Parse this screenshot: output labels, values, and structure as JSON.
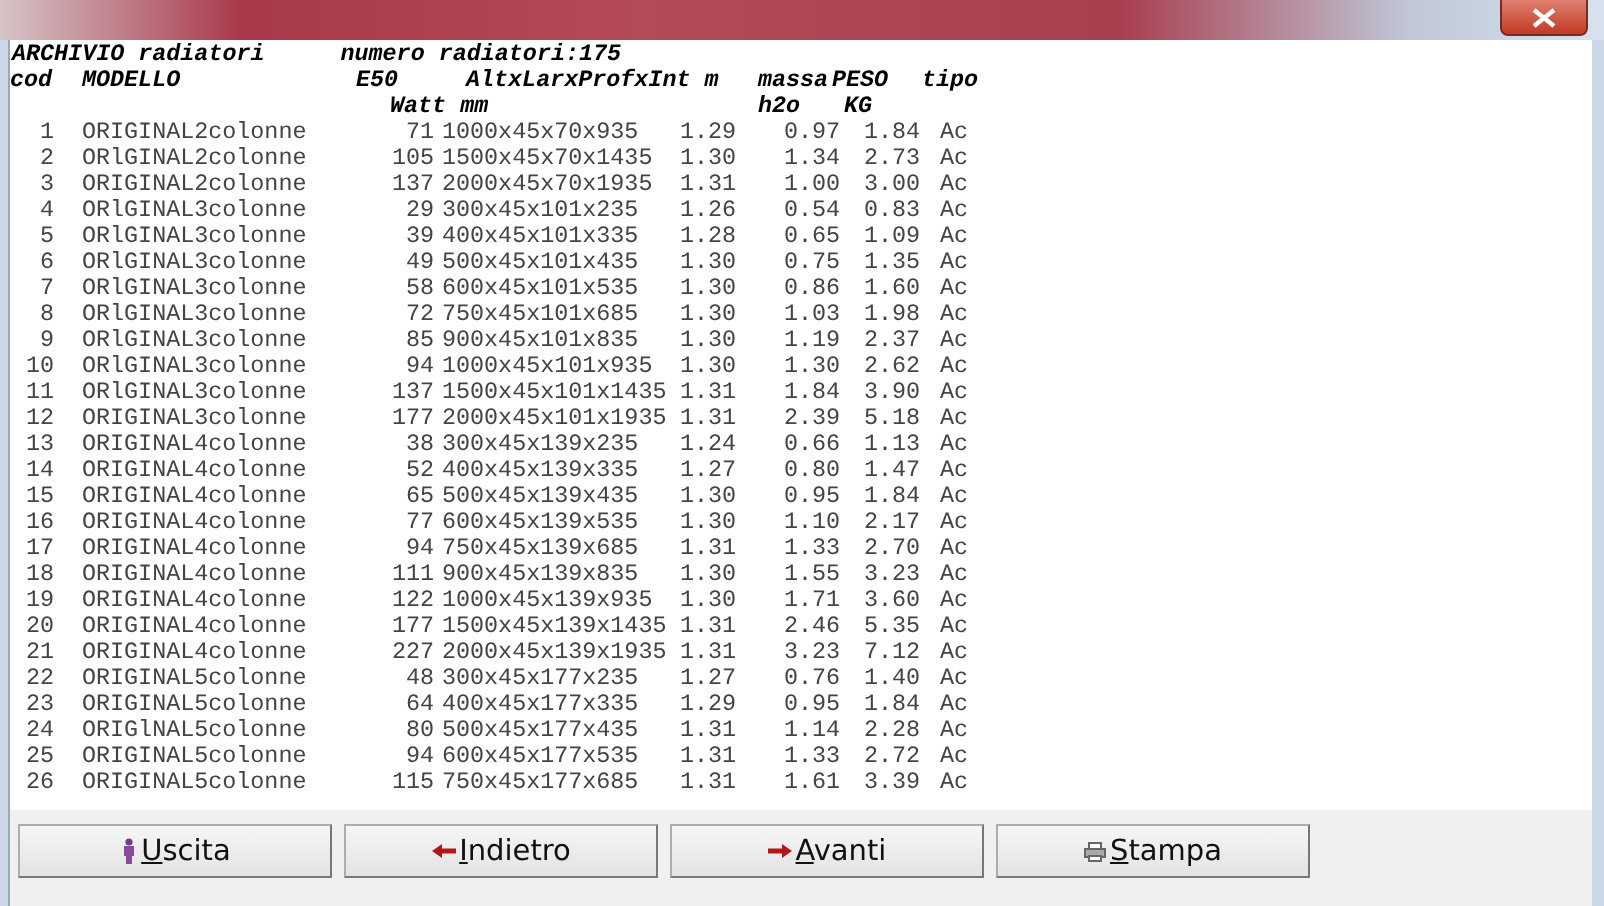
{
  "header": {
    "title": "ARCHIVIO radiatori",
    "count": "numero radiatori:175"
  },
  "columns": {
    "cod": "cod",
    "model": "MODELLO",
    "e50": "E50",
    "dims": "AltxLarxProfxInt m",
    "massa": "massa",
    "peso": "PESO",
    "tipo": "tipo"
  },
  "units": {
    "e50": "Watt mm",
    "massa": "h2o",
    "peso": "KG"
  },
  "rows": [
    {
      "cod": "1",
      "model": "ORIGINAL2colonne",
      "e50": "71",
      "dims": "1000x45x70x935",
      "m": "1.29",
      "massa": "0.97",
      "peso": "1.84",
      "tipo": "Ac"
    },
    {
      "cod": "2",
      "model": "ORlGINAL2colonne",
      "e50": "105",
      "dims": "1500x45x70x1435",
      "m": "1.30",
      "massa": "1.34",
      "peso": "2.73",
      "tipo": "Ac"
    },
    {
      "cod": "3",
      "model": "ORIGINAL2colonne",
      "e50": "137",
      "dims": "2000x45x70x1935",
      "m": "1.31",
      "massa": "1.00",
      "peso": "3.00",
      "tipo": "Ac"
    },
    {
      "cod": "4",
      "model": "ORlGINAL3colonne",
      "e50": "29",
      "dims": "300x45x101x235",
      "m": "1.26",
      "massa": "0.54",
      "peso": "0.83",
      "tipo": "Ac"
    },
    {
      "cod": "5",
      "model": "ORlGINAL3colonne",
      "e50": "39",
      "dims": "400x45x101x335",
      "m": "1.28",
      "massa": "0.65",
      "peso": "1.09",
      "tipo": "Ac"
    },
    {
      "cod": "6",
      "model": "ORlGINAL3colonne",
      "e50": "49",
      "dims": "500x45x101x435",
      "m": "1.30",
      "massa": "0.75",
      "peso": "1.35",
      "tipo": "Ac"
    },
    {
      "cod": "7",
      "model": "ORlGINAL3colonne",
      "e50": "58",
      "dims": "600x45x101x535",
      "m": "1.30",
      "massa": "0.86",
      "peso": "1.60",
      "tipo": "Ac"
    },
    {
      "cod": "8",
      "model": "ORlGINAL3colonne",
      "e50": "72",
      "dims": "750x45x101x685",
      "m": "1.30",
      "massa": "1.03",
      "peso": "1.98",
      "tipo": "Ac"
    },
    {
      "cod": "9",
      "model": "ORlGINAL3colonne",
      "e50": "85",
      "dims": "900x45x101x835",
      "m": "1.30",
      "massa": "1.19",
      "peso": "2.37",
      "tipo": "Ac"
    },
    {
      "cod": "10",
      "model": "ORlGINAL3colonne",
      "e50": "94",
      "dims": "1000x45x101x935",
      "m": "1.30",
      "massa": "1.30",
      "peso": "2.62",
      "tipo": "Ac"
    },
    {
      "cod": "11",
      "model": "ORlGINAL3colonne",
      "e50": "137",
      "dims": "1500x45x101x1435",
      "m": "1.31",
      "massa": "1.84",
      "peso": "3.90",
      "tipo": "Ac"
    },
    {
      "cod": "12",
      "model": "ORIGINAL3colonne",
      "e50": "177",
      "dims": "2000x45x101x1935",
      "m": "1.31",
      "massa": "2.39",
      "peso": "5.18",
      "tipo": "Ac"
    },
    {
      "cod": "13",
      "model": "ORIGINAL4colonne",
      "e50": "38",
      "dims": "300x45x139x235",
      "m": "1.24",
      "massa": "0.66",
      "peso": "1.13",
      "tipo": "Ac"
    },
    {
      "cod": "14",
      "model": "ORIGINAL4colonne",
      "e50": "52",
      "dims": "400x45x139x335",
      "m": "1.27",
      "massa": "0.80",
      "peso": "1.47",
      "tipo": "Ac"
    },
    {
      "cod": "15",
      "model": "ORIGINAL4colonne",
      "e50": "65",
      "dims": "500x45x139x435",
      "m": "1.30",
      "massa": "0.95",
      "peso": "1.84",
      "tipo": "Ac"
    },
    {
      "cod": "16",
      "model": "ORIGINAL4colonne",
      "e50": "77",
      "dims": "600x45x139x535",
      "m": "1.30",
      "massa": "1.10",
      "peso": "2.17",
      "tipo": "Ac"
    },
    {
      "cod": "17",
      "model": "ORIGINAL4colonne",
      "e50": "94",
      "dims": "750x45x139x685",
      "m": "1.31",
      "massa": "1.33",
      "peso": "2.70",
      "tipo": "Ac"
    },
    {
      "cod": "18",
      "model": "ORIGINAL4colonne",
      "e50": "111",
      "dims": "900x45x139x835",
      "m": "1.30",
      "massa": "1.55",
      "peso": "3.23",
      "tipo": "Ac"
    },
    {
      "cod": "19",
      "model": "ORIGINAL4colonne",
      "e50": "122",
      "dims": "1000x45x139x935",
      "m": "1.30",
      "massa": "1.71",
      "peso": "3.60",
      "tipo": "Ac"
    },
    {
      "cod": "20",
      "model": "ORIGINAL4colonne",
      "e50": "177",
      "dims": "1500x45x139x1435",
      "m": "1.31",
      "massa": "2.46",
      "peso": "5.35",
      "tipo": "Ac"
    },
    {
      "cod": "21",
      "model": "ORIGINAL4colonne",
      "e50": "227",
      "dims": "2000x45x139x1935",
      "m": "1.31",
      "massa": "3.23",
      "peso": "7.12",
      "tipo": "Ac"
    },
    {
      "cod": "22",
      "model": "ORIGINAL5colonne",
      "e50": "48",
      "dims": "300x45x177x235",
      "m": "1.27",
      "massa": "0.76",
      "peso": "1.40",
      "tipo": "Ac"
    },
    {
      "cod": "23",
      "model": "ORIGINAL5colonne",
      "e50": "64",
      "dims": "400x45x177x335",
      "m": "1.29",
      "massa": "0.95",
      "peso": "1.84",
      "tipo": "Ac"
    },
    {
      "cod": "24",
      "model": "ORIGlNAL5colonne",
      "e50": "80",
      "dims": "500x45x177x435",
      "m": "1.31",
      "massa": "1.14",
      "peso": "2.28",
      "tipo": "Ac"
    },
    {
      "cod": "25",
      "model": "ORIGINAL5colonne",
      "e50": "94",
      "dims": "600x45x177x535",
      "m": "1.31",
      "massa": "1.33",
      "peso": "2.72",
      "tipo": "Ac"
    },
    {
      "cod": "26",
      "model": "ORIGINAL5colonne",
      "e50": "115",
      "dims": "750x45x177x685",
      "m": "1.31",
      "massa": "1.61",
      "peso": "3.39",
      "tipo": "Ac"
    }
  ],
  "buttons": [
    {
      "kind": "exit",
      "label": "Uscita"
    },
    {
      "kind": "back",
      "label": "Indietro"
    },
    {
      "kind": "forward",
      "label": "Avanti"
    },
    {
      "kind": "print",
      "label": "Stampa"
    }
  ]
}
